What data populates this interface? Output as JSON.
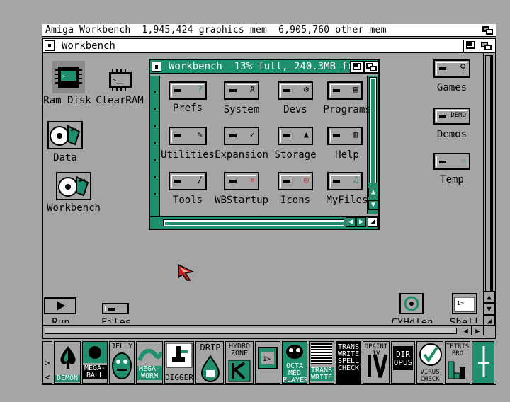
{
  "screen": {
    "title": "Amiga Workbench  1,945,424 graphics mem  6,905,760 other mem"
  },
  "root_window": {
    "title": "Workbench",
    "icons": [
      {
        "key": "ramdisk",
        "label": "Ram Disk",
        "icon": "ram-disk-chip-icon"
      },
      {
        "key": "clearram",
        "label": "ClearRAM",
        "icon": "clearram-tool-icon"
      },
      {
        "key": "data",
        "label": "Data",
        "icon": "hard-disk-icon"
      },
      {
        "key": "workbench",
        "label": "Workbench",
        "icon": "hard-disk-icon"
      },
      {
        "key": "games",
        "label": "Games",
        "icon": "drawer-icon"
      },
      {
        "key": "demos",
        "label": "Demos",
        "icon": "drawer-icon"
      },
      {
        "key": "temp",
        "label": "Temp",
        "icon": "drawer-icon"
      },
      {
        "key": "run",
        "label": "Run",
        "icon": "play-icon"
      },
      {
        "key": "files",
        "label": "Files",
        "icon": "drawer-icon"
      },
      {
        "key": "cyhdlen",
        "label": "CYHdlen",
        "icon": "tool-icon"
      },
      {
        "key": "shell",
        "label": "Shell",
        "icon": "shell-icon"
      }
    ]
  },
  "inner_window": {
    "title": "Workbench  13% full, 240.3MB fr",
    "drawers": [
      {
        "label": "Prefs"
      },
      {
        "label": "System"
      },
      {
        "label": "Devs"
      },
      {
        "label": "Programs"
      },
      {
        "label": "Utilities"
      },
      {
        "label": "Expansion"
      },
      {
        "label": "Storage"
      },
      {
        "label": "Help"
      },
      {
        "label": "Tools"
      },
      {
        "label": "WBStartup"
      },
      {
        "label": "Icons"
      },
      {
        "label": "MyFiles"
      }
    ]
  },
  "dock": {
    "items": [
      {
        "label": "DEMON"
      },
      {
        "label": "MEGA-\nBALL"
      },
      {
        "label": "JELLY"
      },
      {
        "label": "MEGA-\nWORM"
      },
      {
        "label": "DIGGER"
      },
      {
        "label": "DRIP"
      },
      {
        "label": "HYDRO\nZONE"
      },
      {
        "label": ""
      },
      {
        "label": "OCTA\nMED\nPLAYER"
      },
      {
        "label": "TRANS\nWRITE"
      },
      {
        "label": "TRANS\nWRITE\nSPELL\nCHECK"
      },
      {
        "label": "DPAINT\nIV"
      },
      {
        "label": "DIR\nOPUS"
      },
      {
        "label": "VIRUS\nCHECK"
      },
      {
        "label": "TETRIS\nPRO"
      },
      {
        "label": ""
      }
    ]
  },
  "colors": {
    "desktop": "#a5a5a5",
    "accent_green": "#1f8f6f",
    "white": "#ffffff",
    "black": "#000000",
    "cursor": "#cc2222"
  }
}
